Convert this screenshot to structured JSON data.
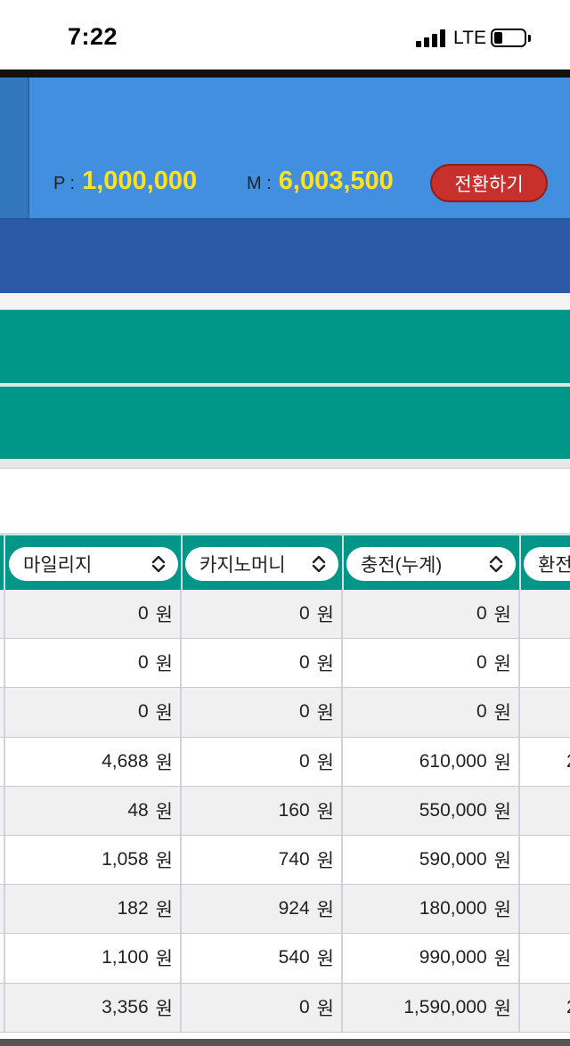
{
  "status_bar": {
    "time": "7:22",
    "network": "LTE"
  },
  "header": {
    "points_label": "P :",
    "points_value": "1,000,000",
    "money_label": "M :",
    "money_value": "6,003,500",
    "convert_button": "전환하기",
    "colors": {
      "header_bg": "#428fe0",
      "value_yellow": "#ffe21a",
      "button_red": "#c7302b",
      "nav_bg": "#2c5aa7",
      "teal": "#009688"
    }
  },
  "table": {
    "columns": [
      "마일리지",
      "카지노머니",
      "충전(누계)",
      "환전"
    ],
    "unit": "원",
    "rows": [
      {
        "mileage": "0",
        "casino_money": "0",
        "charge_total": "0",
        "exchange": ""
      },
      {
        "mileage": "0",
        "casino_money": "0",
        "charge_total": "0",
        "exchange": ""
      },
      {
        "mileage": "0",
        "casino_money": "0",
        "charge_total": "0",
        "exchange": ""
      },
      {
        "mileage": "4,688",
        "casino_money": "0",
        "charge_total": "610,000",
        "exchange": "2"
      },
      {
        "mileage": "48",
        "casino_money": "160",
        "charge_total": "550,000",
        "exchange": ""
      },
      {
        "mileage": "1,058",
        "casino_money": "740",
        "charge_total": "590,000",
        "exchange": ""
      },
      {
        "mileage": "182",
        "casino_money": "924",
        "charge_total": "180,000",
        "exchange": ""
      },
      {
        "mileage": "1,100",
        "casino_money": "540",
        "charge_total": "990,000",
        "exchange": ""
      },
      {
        "mileage": "3,356",
        "casino_money": "0",
        "charge_total": "1,590,000",
        "exchange": "2"
      }
    ]
  }
}
